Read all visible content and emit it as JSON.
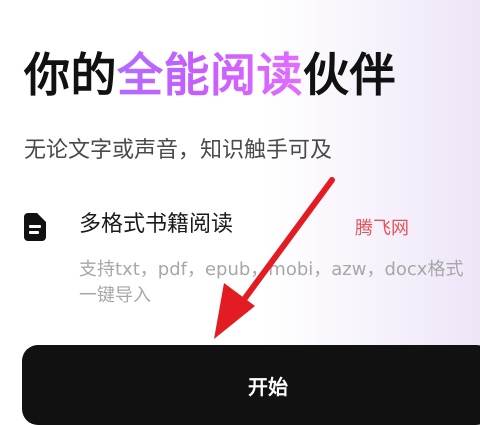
{
  "hero": {
    "title_before": "你的",
    "title_accent": "全能阅读",
    "title_after": "伙伴",
    "subtitle": "无论文字或声音，知识触手可及"
  },
  "feature": {
    "icon": "document-icon",
    "title": "多格式书籍阅读",
    "description": "支持txt，pdf，epub，mobi，azw，docx格式一键导入"
  },
  "watermark": {
    "text": "腾飞网"
  },
  "actions": {
    "start_label": "开始"
  },
  "colors": {
    "accent_gradient": [
      "#b06cff",
      "#c85cff",
      "#e26dff"
    ],
    "button_background": "#111111",
    "annotation_arrow": "#e31b23",
    "watermark": "#e35357"
  }
}
